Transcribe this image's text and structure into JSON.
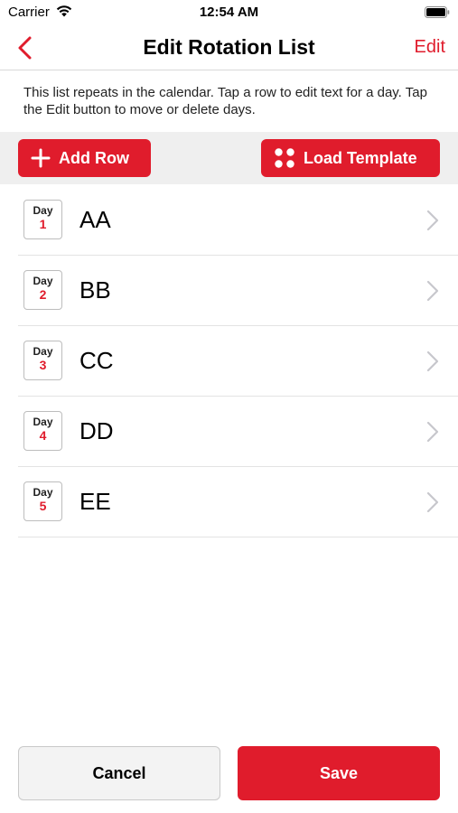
{
  "status_bar": {
    "carrier": "Carrier",
    "time": "12:54 AM",
    "wifi_icon": "wifi-icon",
    "battery_icon": "battery-icon"
  },
  "nav": {
    "back_icon": "chevron-left-icon",
    "title": "Edit Rotation List",
    "edit_label": "Edit"
  },
  "info_text": "This list repeats in the calendar. Tap a row to edit text for a day. Tap the Edit button to move or delete days.",
  "toolbar": {
    "add_row_label": "Add Row",
    "add_row_icon": "plus-icon",
    "load_template_label": "Load Template",
    "load_template_icon": "dots-grid-icon"
  },
  "days": [
    {
      "badge_label": "Day",
      "number": "1",
      "text": "AA"
    },
    {
      "badge_label": "Day",
      "number": "2",
      "text": "BB"
    },
    {
      "badge_label": "Day",
      "number": "3",
      "text": "CC"
    },
    {
      "badge_label": "Day",
      "number": "4",
      "text": "DD"
    },
    {
      "badge_label": "Day",
      "number": "5",
      "text": "EE"
    }
  ],
  "footer": {
    "cancel_label": "Cancel",
    "save_label": "Save"
  },
  "colors": {
    "accent": "#e01c2c",
    "toolbar_bg": "#efefef",
    "cancel_bg": "#f3f3f3"
  }
}
